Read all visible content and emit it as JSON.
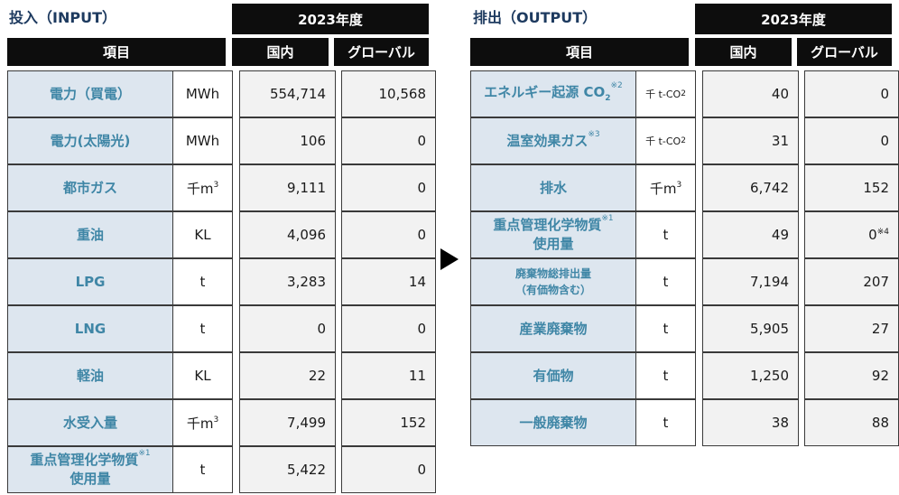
{
  "input": {
    "title": "投入（INPUT）",
    "year": "2023年度",
    "col_item": "項目",
    "col_domestic": "国内",
    "col_global": "グローバル",
    "rows": [
      {
        "item": "電力（買電）",
        "unit": "MWh",
        "domestic": "554,714",
        "global": "10,568"
      },
      {
        "item": "電力(太陽光)",
        "unit": "MWh",
        "domestic": "106",
        "global": "0"
      },
      {
        "item": "都市ガス",
        "unit": "千m",
        "unit_sup": "3",
        "domestic": "9,111",
        "global": "0"
      },
      {
        "item": "重油",
        "unit": "KL",
        "domestic": "4,096",
        "global": "0"
      },
      {
        "item": "LPG",
        "unit": "t",
        "domestic": "3,283",
        "global": "14"
      },
      {
        "item": "LNG",
        "unit": "t",
        "domestic": "0",
        "global": "0"
      },
      {
        "item": "軽油",
        "unit": "KL",
        "domestic": "22",
        "global": "11"
      },
      {
        "item": "水受入量",
        "unit": "千m",
        "unit_sup": "3",
        "domestic": "7,499",
        "global": "152"
      },
      {
        "item": "重点管理化学物質",
        "item_sup": "※1",
        "item_line2": "使用量",
        "unit": "t",
        "domestic": "5,422",
        "global": "0"
      }
    ]
  },
  "output": {
    "title": "排出（OUTPUT）",
    "year": "2023年度",
    "col_item": "項目",
    "col_domestic": "国内",
    "col_global": "グローバル",
    "rows": [
      {
        "item": "エネルギー起源 CO",
        "item_sub": "2",
        "item_sup": "※2",
        "unit": "千 t-CO",
        "unit_sub": "2",
        "domestic": "40",
        "global": "0"
      },
      {
        "item": "温室効果ガス",
        "item_sup": "※3",
        "unit": "千 t-CO",
        "unit_sub": "2",
        "domestic": "31",
        "global": "0"
      },
      {
        "item": "排水",
        "unit": "千m",
        "unit_sup": "3",
        "domestic": "6,742",
        "global": "152"
      },
      {
        "item": "重点管理化学物質",
        "item_sup": "※1",
        "item_line2": "使用量",
        "unit": "t",
        "domestic": "49",
        "global": "0",
        "global_sup": "※4"
      },
      {
        "item": "廃棄物総排出量",
        "item_line2": "（有価物含む）",
        "unit": "t",
        "domestic": "7,194",
        "global": "207"
      },
      {
        "item": "産業廃棄物",
        "unit": "t",
        "domestic": "5,905",
        "global": "27"
      },
      {
        "item": "有価物",
        "unit": "t",
        "domestic": "1,250",
        "global": "92"
      },
      {
        "item": "一般廃棄物",
        "unit": "t",
        "domestic": "38",
        "global": "88"
      }
    ]
  }
}
